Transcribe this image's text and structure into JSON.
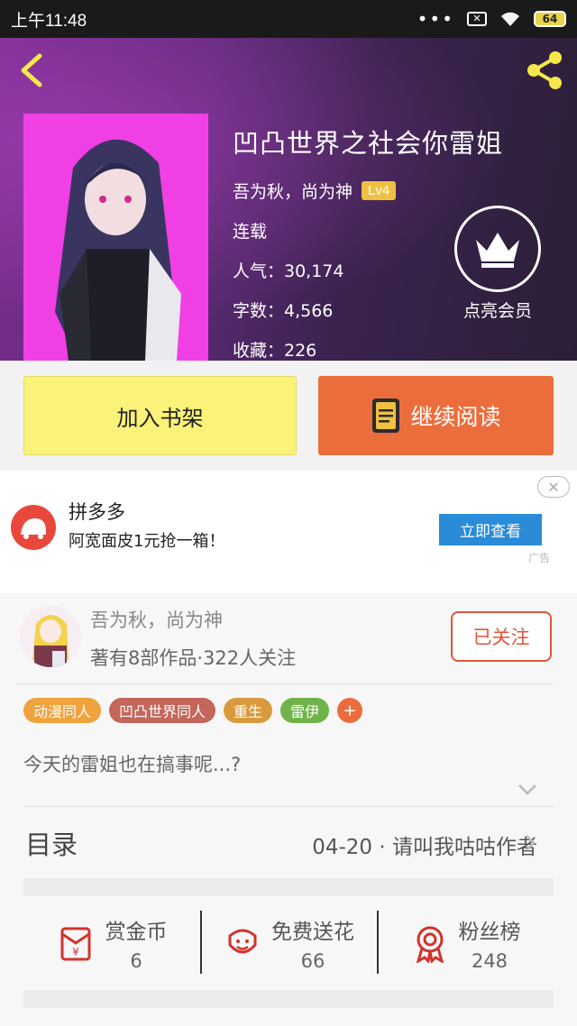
{
  "status_bar": {
    "time": "上午11:48",
    "sim_label": "✕",
    "battery": "64"
  },
  "book": {
    "title": "凹凸世界之社会你雷姐",
    "author": "吾为秋，尚为神",
    "author_level": "Lv4",
    "status": "连载",
    "popularity": "人气：30,174",
    "word_count": "字数：4,566",
    "favorites": "收藏：226"
  },
  "member": {
    "label": "点亮会员"
  },
  "actions": {
    "add_shelf": "加入书架",
    "continue_read": "继续阅读"
  },
  "ad": {
    "title": "拼多多",
    "description": "阿宽面皮1元抢一箱！",
    "button": "立即查看",
    "tag": "广告",
    "close": "✕"
  },
  "author_card": {
    "name": "吾为秋，尚为神",
    "works": "著有8部作品·322人关注",
    "follow_button": "已关注"
  },
  "tags": [
    {
      "label": "动漫同人",
      "color": "#f0a23c"
    },
    {
      "label": "凹凸世界同人",
      "color": "#c4665a"
    },
    {
      "label": "重生",
      "color": "#d99a3e"
    },
    {
      "label": "雷伊",
      "color": "#6fb34a"
    }
  ],
  "tag_more": "+",
  "intro": "今天的雷姐也在搞事呢...?",
  "toc": {
    "label": "目录",
    "latest": "04-20 · 请叫我咕咕作者"
  },
  "stats": [
    {
      "label": "赏金币",
      "value": "6",
      "icon": "coin-envelope-icon"
    },
    {
      "label": "免费送花",
      "value": "66",
      "icon": "flower-icon"
    },
    {
      "label": "粉丝榜",
      "value": "248",
      "icon": "medal-icon"
    }
  ],
  "colors": {
    "accent": "#ec6d3c",
    "shelf_button": "#fbf27a",
    "ad_button": "#2a8bd8",
    "follow": "#e2553c"
  }
}
